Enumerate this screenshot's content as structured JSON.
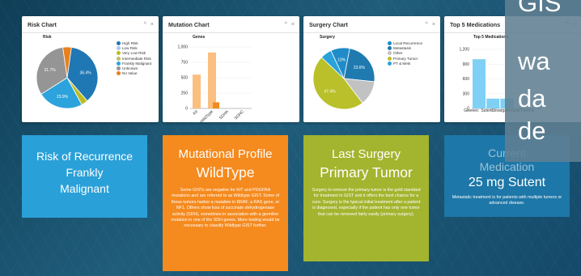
{
  "panels": [
    {
      "title": "Risk Chart"
    },
    {
      "title": "Mutation Chart"
    },
    {
      "title": "Surgery Chart"
    },
    {
      "title": "Top 5 Medications"
    }
  ],
  "controls": {
    "collapse": "^",
    "close": "×"
  },
  "colors": {
    "risk_blue": "#1f77b4",
    "risk_light": "#aec7e8",
    "risk_olive": "#bcbd22",
    "gray": "#959595",
    "mutation_orange": "#fbbf7f",
    "mutation_dark": "#f28c1d",
    "med_light": "#7fd0f5",
    "med_dark": "#1f77b4"
  },
  "chart_data": [
    {
      "type": "pie",
      "title": "Risk",
      "labels": [
        "High Risk",
        "Low Risk",
        "Very Low Risk",
        "Intermediate Risk",
        "Frankly Malignant",
        "Unknown",
        "No Value"
      ],
      "values": [
        36.4,
        0,
        3.5,
        0,
        23.9,
        31.7,
        4.5
      ],
      "slice_labels": [
        "36.4%",
        "23.9%",
        "31.7%"
      ],
      "legend": "right"
    },
    {
      "type": "bar",
      "title": "Genes",
      "categories": [
        "Kit",
        "WildType",
        "SDHA",
        "SDHC"
      ],
      "series": [
        {
          "values": [
            550,
            910,
            0,
            0
          ]
        },
        {
          "values": [
            0,
            100,
            0,
            0
          ]
        }
      ],
      "ylim": [
        0,
        1000
      ],
      "yticks": [
        "0",
        "250",
        "500",
        "750",
        "1,000"
      ]
    },
    {
      "type": "pie",
      "title": "Surgery",
      "labels": [
        "Local Recurrence",
        "Metastasis",
        "Other",
        "Primary Tumor",
        "PT & Mets"
      ],
      "values": [
        10,
        23.6,
        13,
        47.4,
        6
      ],
      "slice_labels": [
        "10%",
        "23.6%",
        "47.4%"
      ],
      "legend": "right"
    },
    {
      "type": "bar",
      "title": "Top 5 Medications",
      "categories": [
        "Gleevec",
        "Sutent",
        "Stivarga",
        "Tasigna",
        "Nexavar"
      ],
      "category_tick_labels": [
        "Gleevec",
        "Sutent",
        "Stivarga",
        "Nexavar",
        "Tasigna"
      ],
      "values": [
        1000,
        200,
        200,
        0,
        0
      ],
      "ylim": [
        0,
        1200
      ],
      "yticks": [
        "0",
        "300",
        "600",
        "900",
        "1,200"
      ]
    }
  ],
  "tiles": [
    {
      "lines": [
        "Risk of Recurrence",
        "Frankly",
        "Malignant"
      ]
    },
    {
      "lines": [
        "Mutational Profile",
        "WildType"
      ],
      "desc": "Some GISTs are negative for KIT and PDGFRA mutations and are referred to as Wildtype GIST. Some of these tumors harbor a mutation in BRAF, a RAS gene, or NF1. Others show loss of succinate dehydrogenase activity (SDH), sometimes in association with a germline mutation in one of the SDH genes. More testing would be necessary to classify Wildtype GIST further."
    },
    {
      "lines": [
        "Last Surgery",
        "Primary Tumor"
      ],
      "desc": "Surgery to remove the primary tumor is the gold standard for treatment in GIST and it offers the best chance for a cure. Surgery is the typical initial treatment after a patient is diagnosed, especially if the patient has only one tumor that can be removed fairly easily (primary surgery)."
    },
    {
      "lines": [
        "Current",
        "Medication",
        "25 mg Sutent"
      ],
      "desc": "Metastatic treatment is for patients with multiple tumors or advanced disease."
    }
  ],
  "overlay": {
    "lines": [
      "GIS",
      "wa",
      "da",
      "de"
    ]
  }
}
